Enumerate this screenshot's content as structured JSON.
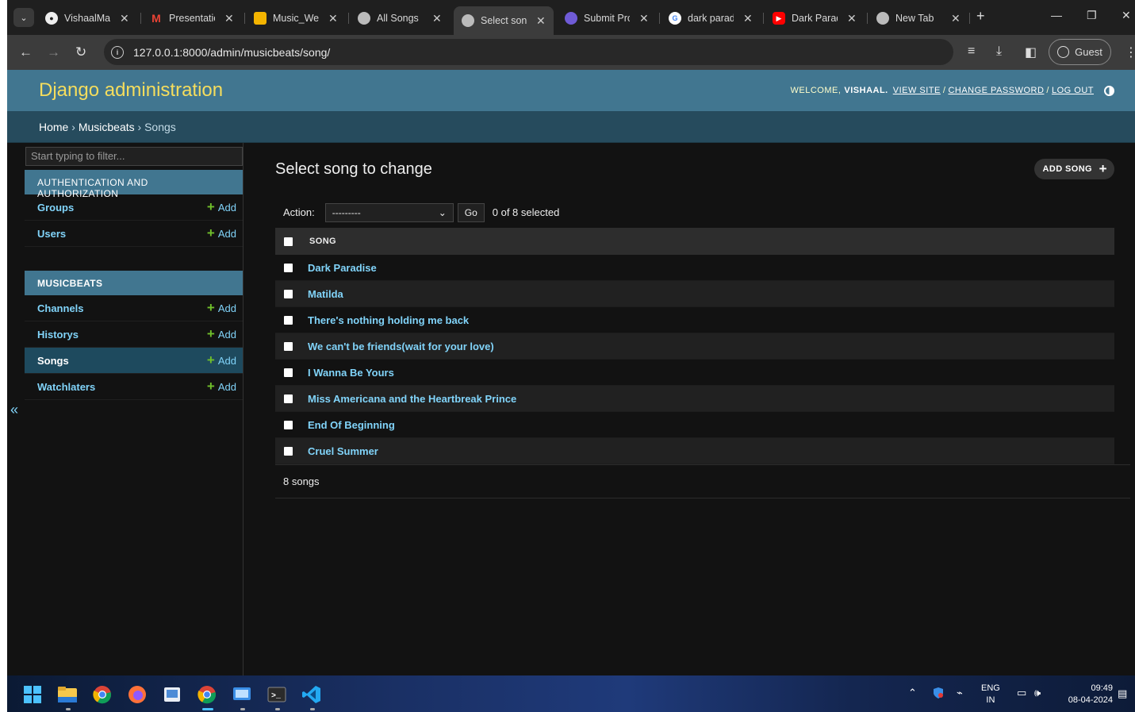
{
  "browser": {
    "tabs": [
      {
        "label": "VishaalMan",
        "icon": "github-icon"
      },
      {
        "label": "Presentatio",
        "icon": "gmail-icon"
      },
      {
        "label": "Music_Web",
        "icon": "slides-icon"
      },
      {
        "label": "All Songs",
        "icon": "globe-icon"
      },
      {
        "label": "Select song",
        "icon": "globe-icon",
        "active": true
      },
      {
        "label": "Submit Pro",
        "icon": "stack-icon"
      },
      {
        "label": "dark paradi",
        "icon": "google-icon"
      },
      {
        "label": "Dark Parad",
        "icon": "youtube-icon"
      },
      {
        "label": "New Tab",
        "icon": "globe-icon"
      }
    ],
    "url": "127.0.0.1:8000/admin/musicbeats/song/",
    "profile": "Guest"
  },
  "header": {
    "branding": "Django administration",
    "welcome": "WELCOME,",
    "user": "VISHAAL.",
    "view_site": "VIEW SITE",
    "change_password": "CHANGE PASSWORD",
    "log_out": "LOG OUT",
    "sep": "/"
  },
  "breadcrumbs": {
    "home": "Home",
    "app": "Musicbeats",
    "model": "Songs",
    "sep": "›"
  },
  "sidebar": {
    "filter_placeholder": "Start typing to filter...",
    "add_label": "Add",
    "modules": [
      {
        "caption": "AUTHENTICATION AND AUTHORIZATION",
        "items": [
          "Groups",
          "Users"
        ]
      },
      {
        "caption": "MUSICBEATS",
        "items": [
          "Channels",
          "Historys",
          "Songs",
          "Watchlaters"
        ]
      }
    ],
    "toggle": "«"
  },
  "main": {
    "title": "Select song to change",
    "add_button": "ADD SONG",
    "action_label": "Action:",
    "action_value": "---------",
    "go": "Go",
    "selected": "0 of 8 selected",
    "column_header": "SONG",
    "songs": [
      "Dark Paradise",
      "Matilda",
      "There's nothing holding me back",
      "We can't be friends(wait for your love)",
      "I Wanna Be Yours",
      "Miss Americana and the Heartbreak Prince",
      "End Of Beginning",
      "Cruel Summer"
    ],
    "count": "8 songs"
  },
  "taskbar": {
    "lang": "ENG",
    "region": "IN",
    "time": "09:49",
    "date": "08-04-2024"
  }
}
